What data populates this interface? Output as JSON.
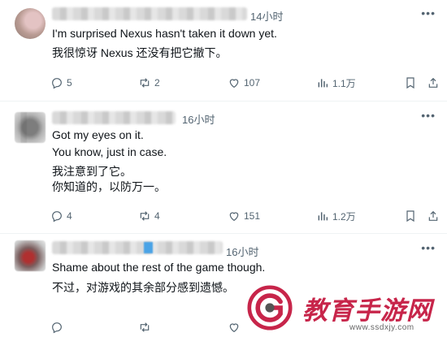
{
  "colors": {
    "text": "#0f1419",
    "muted": "#536471",
    "divider": "#eff3f4",
    "watermark": "#c7254a"
  },
  "tweets": [
    {
      "time": "14小时",
      "lines": [
        "I'm surprised Nexus hasn't taken it down yet.",
        "我很惊讶 Nexus 还没有把它撤下。"
      ],
      "replies": "5",
      "retweets": "2",
      "likes": "107",
      "views": "1.1万"
    },
    {
      "time": "16小时",
      "lines": [
        "Got my eyes on it.",
        "You know, just in case.",
        "我注意到了它。",
        "你知道的，以防万一。"
      ],
      "replies": "4",
      "retweets": "4",
      "likes": "151",
      "views": "1.2万"
    },
    {
      "time": "16小时",
      "lines": [
        "Shame about the rest of the game though.",
        "不过，对游戏的其余部分感到遗憾。"
      ],
      "replies": "",
      "retweets": "",
      "likes": "",
      "views": ""
    }
  ],
  "icons": [
    "reply-icon",
    "retweet-icon",
    "like-icon",
    "views-icon",
    "bookmark-icon",
    "share-icon",
    "more-icon"
  ],
  "watermark": {
    "text": "教育手游网",
    "url": "www.ssdxjy.com"
  }
}
